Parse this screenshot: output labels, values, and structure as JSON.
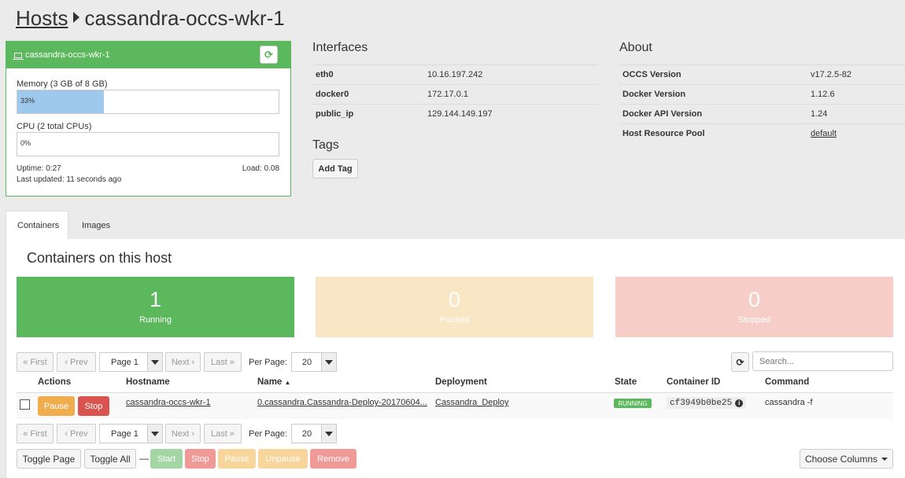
{
  "header": {
    "breadcrumb": "Hosts",
    "title": "cassandra-occs-wkr-1"
  },
  "host_panel": {
    "name": "cassandra-occs-wkr-1",
    "memory_label": "Memory (3 GB of 8 GB)",
    "memory_percent": 33,
    "memory_percent_text": "33%",
    "cpu_label": "CPU (2 total CPUs)",
    "cpu_percent": 0,
    "cpu_percent_text": "0%",
    "uptime": "Uptime: 0:27",
    "load": "Load: 0.08",
    "last_updated": "Last updated: 11 seconds ago"
  },
  "interfaces": {
    "title": "Interfaces",
    "rows": [
      {
        "name": "eth0",
        "ip": "10.16.197.242"
      },
      {
        "name": "docker0",
        "ip": "172.17.0.1"
      },
      {
        "name": "public_ip",
        "ip": "129.144.149.197"
      }
    ]
  },
  "tags": {
    "title": "Tags",
    "add_label": "Add Tag"
  },
  "about": {
    "title": "About",
    "rows": [
      {
        "key": "OCCS Version",
        "value": "v17.2.5-82"
      },
      {
        "key": "Docker Version",
        "value": "1.12.6"
      },
      {
        "key": "Docker API Version",
        "value": "1.24"
      },
      {
        "key": "Host Resource Pool",
        "value": "default"
      }
    ]
  },
  "tabs": [
    {
      "label": "Containers"
    },
    {
      "label": "Images"
    }
  ],
  "containers": {
    "title": "Containers on this host",
    "tiles": [
      {
        "count": "1",
        "label": "Running",
        "color": "#5cb85c"
      },
      {
        "count": "0",
        "label": "Paused",
        "color": "#f8e6c4"
      },
      {
        "count": "0",
        "label": "Stopped",
        "color": "#f7cdc8"
      }
    ],
    "pager": {
      "first": "« First",
      "prev": "‹ Prev",
      "page": "Page 1",
      "next": "Next ›",
      "last": "Last »",
      "per_page_label": "Per Page:",
      "per_page": "20"
    },
    "search_placeholder": "Search...",
    "columns": [
      "Actions",
      "Hostname",
      "Name",
      "Deployment",
      "State",
      "Container ID",
      "Command"
    ],
    "rows": [
      {
        "pause": "Pause",
        "stop": "Stop",
        "hostname": "cassandra-occs-wkr-1",
        "name": "0.cassandra.Cassandra-Deploy-20170604...",
        "deployment": "Cassandra_Deploy",
        "state": "RUNNING",
        "container_id": "cf3949b0be25",
        "command": "cassandra -f"
      }
    ],
    "bulk": {
      "toggle_page": "Toggle Page",
      "toggle_all": "Toggle All",
      "dash": "—",
      "start": "Start",
      "stop": "Stop",
      "pause": "Pause",
      "unpause": "Unpause",
      "remove": "Remove",
      "choose_columns": "Choose Columns"
    }
  },
  "colors": {
    "success": "#5cb85c",
    "warning": "#f0ad4e",
    "danger": "#d9534f"
  }
}
